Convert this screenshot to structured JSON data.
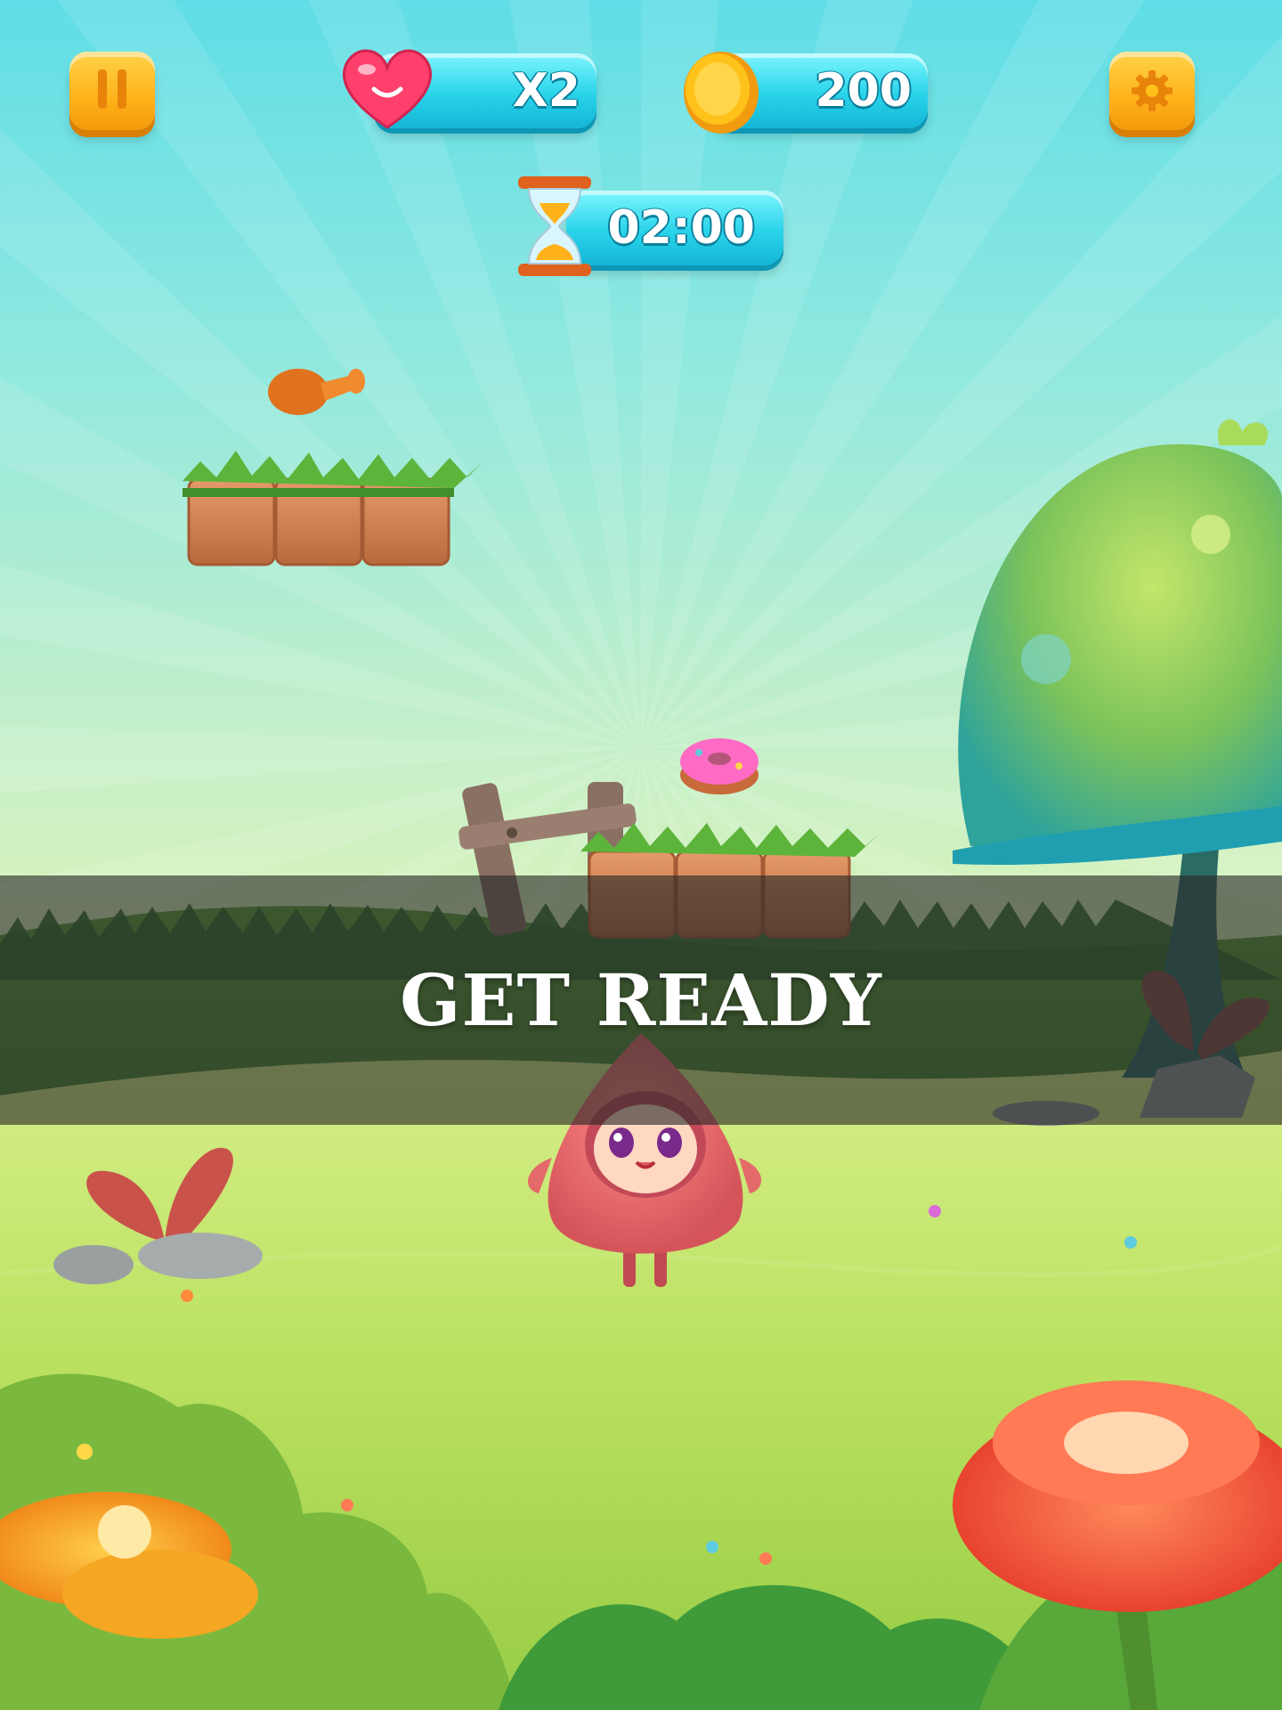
{
  "hud": {
    "pause_label": "II",
    "lives": {
      "value": "X2",
      "icon": "heart-icon"
    },
    "coins": {
      "value": "200",
      "icon": "coin-icon"
    },
    "settings_icon": "gear-icon",
    "timer": {
      "value": "02:00",
      "icon": "hourglass-icon"
    }
  },
  "overlay": {
    "message": "GET READY"
  },
  "colors": {
    "hud_button": "#ffb21a",
    "hud_pill": "#29d3ea",
    "heart": "#ff3f6c",
    "coin": "#ffc21a",
    "banner": "#3a3a3a"
  }
}
